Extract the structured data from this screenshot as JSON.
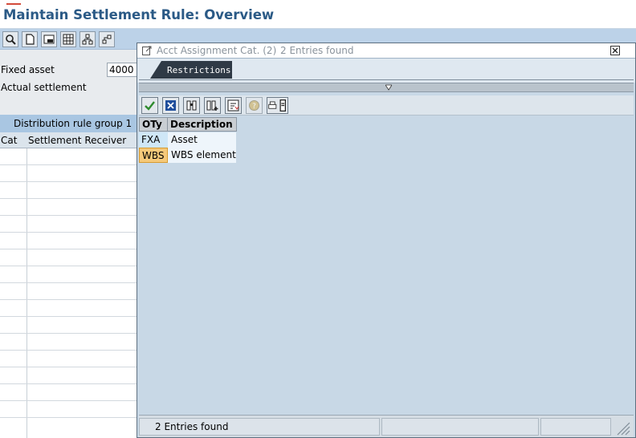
{
  "window": {
    "title": "Maintain Settlement Rule: Overview"
  },
  "app_toolbar": {
    "buttons": [
      {
        "icon": "magnifier-icon"
      },
      {
        "icon": "new-document-icon"
      },
      {
        "icon": "layout-window-icon"
      },
      {
        "icon": "table-grid-icon"
      },
      {
        "icon": "hierarchy-icon"
      },
      {
        "icon": "hierarchy-arrow-icon"
      }
    ]
  },
  "header_fields": {
    "fixed_asset_label": "Fixed asset",
    "fixed_asset_value": "4000",
    "actual_settlement_label": "Actual settlement"
  },
  "distribution": {
    "group_label": "Distribution rule group 1",
    "columns": [
      "Cat",
      "Settlement Receiver"
    ]
  },
  "dialog": {
    "title": "Acct Assignment Cat. (2)",
    "entries_found": "2 Entries found",
    "tab_label": "Restrictions",
    "columns": [
      "OTy",
      "Description"
    ],
    "rows": [
      {
        "key": "FXA",
        "description": "Asset"
      },
      {
        "key": "WBS",
        "description": "WBS element"
      }
    ],
    "status_text": "2 Entries found"
  },
  "colors": {
    "title_text": "#2b5a86",
    "toolbar_bg": "#bcd2e8",
    "dialog_bg": "#c8d8e6",
    "selected_row": "#f5c97a",
    "check_green": "#2e8b2e",
    "cancel_blue": "#1f4e9c"
  }
}
